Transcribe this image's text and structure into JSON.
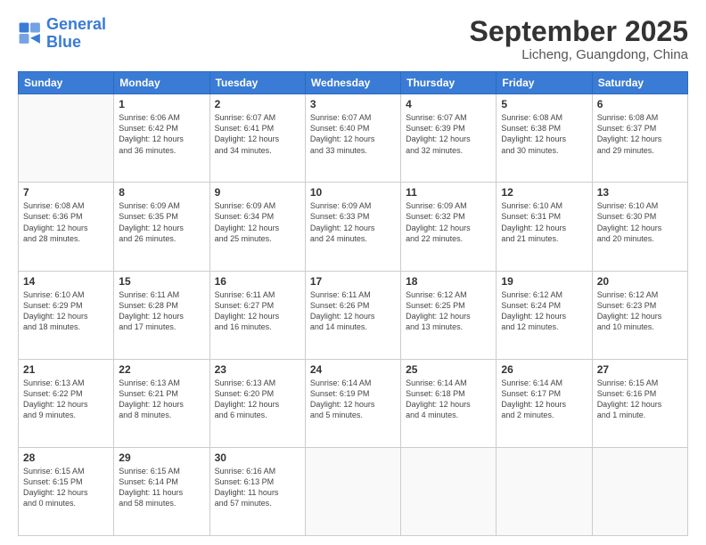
{
  "logo": {
    "line1": "General",
    "line2": "Blue"
  },
  "header": {
    "month": "September 2025",
    "location": "Licheng, Guangdong, China"
  },
  "weekdays": [
    "Sunday",
    "Monday",
    "Tuesday",
    "Wednesday",
    "Thursday",
    "Friday",
    "Saturday"
  ],
  "weeks": [
    [
      {
        "day": "",
        "info": ""
      },
      {
        "day": "1",
        "info": "Sunrise: 6:06 AM\nSunset: 6:42 PM\nDaylight: 12 hours\nand 36 minutes."
      },
      {
        "day": "2",
        "info": "Sunrise: 6:07 AM\nSunset: 6:41 PM\nDaylight: 12 hours\nand 34 minutes."
      },
      {
        "day": "3",
        "info": "Sunrise: 6:07 AM\nSunset: 6:40 PM\nDaylight: 12 hours\nand 33 minutes."
      },
      {
        "day": "4",
        "info": "Sunrise: 6:07 AM\nSunset: 6:39 PM\nDaylight: 12 hours\nand 32 minutes."
      },
      {
        "day": "5",
        "info": "Sunrise: 6:08 AM\nSunset: 6:38 PM\nDaylight: 12 hours\nand 30 minutes."
      },
      {
        "day": "6",
        "info": "Sunrise: 6:08 AM\nSunset: 6:37 PM\nDaylight: 12 hours\nand 29 minutes."
      }
    ],
    [
      {
        "day": "7",
        "info": "Sunrise: 6:08 AM\nSunset: 6:36 PM\nDaylight: 12 hours\nand 28 minutes."
      },
      {
        "day": "8",
        "info": "Sunrise: 6:09 AM\nSunset: 6:35 PM\nDaylight: 12 hours\nand 26 minutes."
      },
      {
        "day": "9",
        "info": "Sunrise: 6:09 AM\nSunset: 6:34 PM\nDaylight: 12 hours\nand 25 minutes."
      },
      {
        "day": "10",
        "info": "Sunrise: 6:09 AM\nSunset: 6:33 PM\nDaylight: 12 hours\nand 24 minutes."
      },
      {
        "day": "11",
        "info": "Sunrise: 6:09 AM\nSunset: 6:32 PM\nDaylight: 12 hours\nand 22 minutes."
      },
      {
        "day": "12",
        "info": "Sunrise: 6:10 AM\nSunset: 6:31 PM\nDaylight: 12 hours\nand 21 minutes."
      },
      {
        "day": "13",
        "info": "Sunrise: 6:10 AM\nSunset: 6:30 PM\nDaylight: 12 hours\nand 20 minutes."
      }
    ],
    [
      {
        "day": "14",
        "info": "Sunrise: 6:10 AM\nSunset: 6:29 PM\nDaylight: 12 hours\nand 18 minutes."
      },
      {
        "day": "15",
        "info": "Sunrise: 6:11 AM\nSunset: 6:28 PM\nDaylight: 12 hours\nand 17 minutes."
      },
      {
        "day": "16",
        "info": "Sunrise: 6:11 AM\nSunset: 6:27 PM\nDaylight: 12 hours\nand 16 minutes."
      },
      {
        "day": "17",
        "info": "Sunrise: 6:11 AM\nSunset: 6:26 PM\nDaylight: 12 hours\nand 14 minutes."
      },
      {
        "day": "18",
        "info": "Sunrise: 6:12 AM\nSunset: 6:25 PM\nDaylight: 12 hours\nand 13 minutes."
      },
      {
        "day": "19",
        "info": "Sunrise: 6:12 AM\nSunset: 6:24 PM\nDaylight: 12 hours\nand 12 minutes."
      },
      {
        "day": "20",
        "info": "Sunrise: 6:12 AM\nSunset: 6:23 PM\nDaylight: 12 hours\nand 10 minutes."
      }
    ],
    [
      {
        "day": "21",
        "info": "Sunrise: 6:13 AM\nSunset: 6:22 PM\nDaylight: 12 hours\nand 9 minutes."
      },
      {
        "day": "22",
        "info": "Sunrise: 6:13 AM\nSunset: 6:21 PM\nDaylight: 12 hours\nand 8 minutes."
      },
      {
        "day": "23",
        "info": "Sunrise: 6:13 AM\nSunset: 6:20 PM\nDaylight: 12 hours\nand 6 minutes."
      },
      {
        "day": "24",
        "info": "Sunrise: 6:14 AM\nSunset: 6:19 PM\nDaylight: 12 hours\nand 5 minutes."
      },
      {
        "day": "25",
        "info": "Sunrise: 6:14 AM\nSunset: 6:18 PM\nDaylight: 12 hours\nand 4 minutes."
      },
      {
        "day": "26",
        "info": "Sunrise: 6:14 AM\nSunset: 6:17 PM\nDaylight: 12 hours\nand 2 minutes."
      },
      {
        "day": "27",
        "info": "Sunrise: 6:15 AM\nSunset: 6:16 PM\nDaylight: 12 hours\nand 1 minute."
      }
    ],
    [
      {
        "day": "28",
        "info": "Sunrise: 6:15 AM\nSunset: 6:15 PM\nDaylight: 12 hours\nand 0 minutes."
      },
      {
        "day": "29",
        "info": "Sunrise: 6:15 AM\nSunset: 6:14 PM\nDaylight: 11 hours\nand 58 minutes."
      },
      {
        "day": "30",
        "info": "Sunrise: 6:16 AM\nSunset: 6:13 PM\nDaylight: 11 hours\nand 57 minutes."
      },
      {
        "day": "",
        "info": ""
      },
      {
        "day": "",
        "info": ""
      },
      {
        "day": "",
        "info": ""
      },
      {
        "day": "",
        "info": ""
      }
    ]
  ]
}
